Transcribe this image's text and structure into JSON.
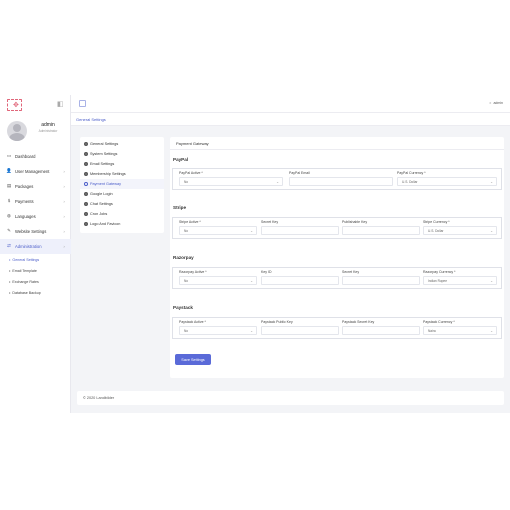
{
  "sidebar": {
    "logo_glyph": "✥",
    "collapse_glyph": "◧",
    "user": {
      "name": "admin",
      "role": "Administrator"
    },
    "nav": [
      {
        "label": "Dashboard",
        "icon": "dashboard-icon",
        "glyph": "▭",
        "chevron": ""
      },
      {
        "label": "User Management",
        "icon": "user-icon",
        "glyph": "👤",
        "chevron": "›"
      },
      {
        "label": "Packages",
        "icon": "package-icon",
        "glyph": "▤",
        "chevron": "›"
      },
      {
        "label": "Payments",
        "icon": "dollar-icon",
        "glyph": "$",
        "chevron": "›"
      },
      {
        "label": "Languages",
        "icon": "globe-icon",
        "glyph": "◍",
        "chevron": "›"
      },
      {
        "label": "Website Settings",
        "icon": "pen-icon",
        "glyph": "✎",
        "chevron": "›"
      },
      {
        "label": "Administration",
        "icon": "swap-icon",
        "glyph": "⇄",
        "chevron": "›"
      }
    ],
    "subnav": [
      {
        "label": "General Settings",
        "active": true
      },
      {
        "label": "Email Template",
        "active": false
      },
      {
        "label": "Exchange Rates",
        "active": false
      },
      {
        "label": "Database Backup",
        "active": false
      }
    ],
    "subnav_dot": "•"
  },
  "topbar": {
    "user_prefix": "○",
    "user_label": "admin"
  },
  "breadcrumb": "General Settings",
  "settings_menu": [
    "General Settings",
    "System Settings",
    "Email Settings",
    "Membership Settings",
    "Payment Gateway",
    "Google Login",
    "Chat Settings",
    "Cron Jobs",
    "Logo And Favicon"
  ],
  "settings_menu_active": 4,
  "panel": {
    "title": "Payment Gateway",
    "sections": {
      "paypal": {
        "title": "PayPal",
        "fields": [
          {
            "label": "PayPal Active *",
            "value": "No",
            "select": true
          },
          {
            "label": "PayPal Email",
            "value": "",
            "select": false
          },
          {
            "label": "PayPal Currency *",
            "value": "U.S. Dollar",
            "select": true
          }
        ]
      },
      "stripe": {
        "title": "Stripe",
        "fields": [
          {
            "label": "Stripe Active *",
            "value": "No",
            "select": true
          },
          {
            "label": "Secret Key",
            "value": "",
            "select": false
          },
          {
            "label": "Publishable Key",
            "value": "",
            "select": false
          },
          {
            "label": "Stripe Currency *",
            "value": "U.S. Dollar",
            "select": true
          }
        ]
      },
      "razorpay": {
        "title": "Razorpay",
        "fields": [
          {
            "label": "Razorpay Active *",
            "value": "No",
            "select": true
          },
          {
            "label": "Key ID",
            "value": "",
            "select": false
          },
          {
            "label": "Secret Key",
            "value": "",
            "select": false
          },
          {
            "label": "Razorpay Currency *",
            "value": "Indian Rupee",
            "select": true
          }
        ]
      },
      "paystack": {
        "title": "Paystack",
        "fields": [
          {
            "label": "Paystack Active *",
            "value": "No",
            "select": true
          },
          {
            "label": "Paystack Public Key",
            "value": "",
            "select": false
          },
          {
            "label": "Paystack Secret Key",
            "value": "",
            "select": false
          },
          {
            "label": "Paystack Currency *",
            "value": "Naira",
            "select": true
          }
        ]
      }
    },
    "save_label": "Save Settings",
    "caret_glyph": "⌄"
  },
  "footer": "© 2020 Landbilder",
  "colors": {
    "accent": "#5a6ad8",
    "link": "#4a5cc9",
    "background": "#f3f4f7"
  }
}
